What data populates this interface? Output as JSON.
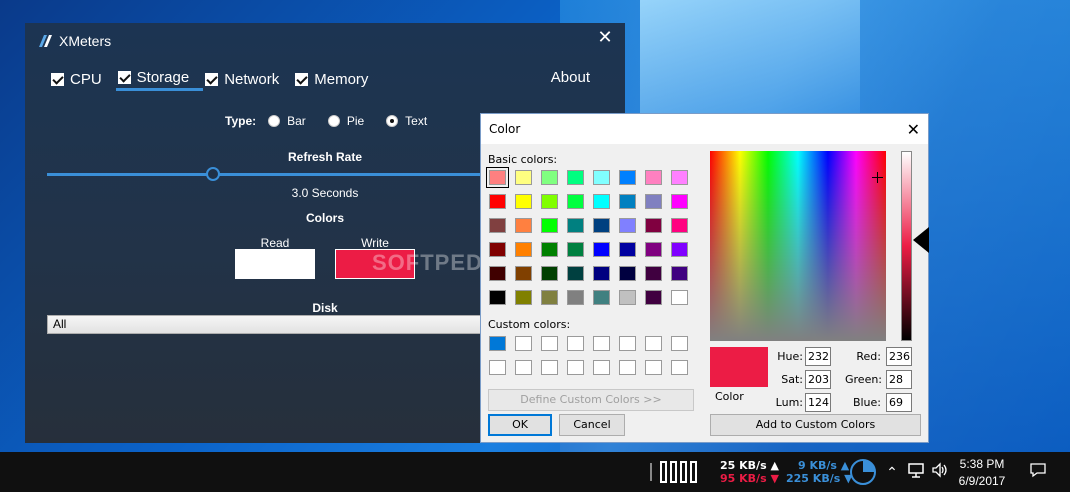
{
  "xmeters": {
    "title": "XMeters",
    "tabs": [
      {
        "label": "CPU",
        "checked": true
      },
      {
        "label": "Storage",
        "checked": true,
        "active": true
      },
      {
        "label": "Network",
        "checked": true
      },
      {
        "label": "Memory",
        "checked": true
      }
    ],
    "about": "About",
    "type_label": "Type:",
    "type_options": [
      "Bar",
      "Pie",
      "Text"
    ],
    "type_selected": "Text",
    "refresh_label": "Refresh Rate",
    "refresh_value": "3.0 Seconds",
    "colors_label": "Colors",
    "read_label": "Read",
    "write_label": "Write",
    "read_color": "#ffffff",
    "write_color": "#ec1c45",
    "disk_label": "Disk",
    "disk_value": "All"
  },
  "color_dialog": {
    "title": "Color",
    "basic_label": "Basic colors:",
    "custom_label": "Custom colors:",
    "basic_colors": [
      "#ff8080",
      "#ffff80",
      "#80ff80",
      "#00ff80",
      "#80ffff",
      "#0080ff",
      "#ff80c0",
      "#ff80ff",
      "#ff0000",
      "#ffff00",
      "#80ff00",
      "#00ff40",
      "#00ffff",
      "#0080c0",
      "#8080c0",
      "#ff00ff",
      "#804040",
      "#ff8040",
      "#00ff00",
      "#008080",
      "#004080",
      "#8080ff",
      "#800040",
      "#ff0080",
      "#800000",
      "#ff8000",
      "#008000",
      "#008040",
      "#0000ff",
      "#0000a0",
      "#800080",
      "#8000ff",
      "#400000",
      "#804000",
      "#004000",
      "#004040",
      "#000080",
      "#000040",
      "#400040",
      "#400080",
      "#000000",
      "#808000",
      "#808040",
      "#808080",
      "#408080",
      "#c0c0c0",
      "#400040",
      "#ffffff"
    ],
    "custom_colors": [
      "#0078d7",
      "",
      "",
      "",
      "",
      "",
      "",
      "",
      "",
      "",
      "",
      "",
      "",
      "",
      "",
      ""
    ],
    "define_custom": "Define Custom Colors >>",
    "ok": "OK",
    "cancel": "Cancel",
    "color_label": "Color",
    "hue_label": "Hue:",
    "hue": "232",
    "sat_label": "Sat:",
    "sat": "203",
    "lum_label": "Lum:",
    "lum": "124",
    "red_label": "Red:",
    "red": "236",
    "green_label": "Green:",
    "green": "28",
    "blue_label": "Blue:",
    "blue": "69",
    "add_custom": "Add to Custom Colors",
    "current_color": "#ec1c45"
  },
  "taskbar": {
    "storage_read": "25 KB/s ▲",
    "storage_write": "95 KB/s ▼",
    "net_up": "9 KB/s ▲",
    "net_down": "225 KB/s ▼",
    "time": "5:38 PM",
    "date": "6/9/2017",
    "read_text_color": "#ffffff",
    "write_text_color": "#ec1c45",
    "net_color": "#3a8fd8"
  },
  "watermark": "SOFTPEDIA"
}
